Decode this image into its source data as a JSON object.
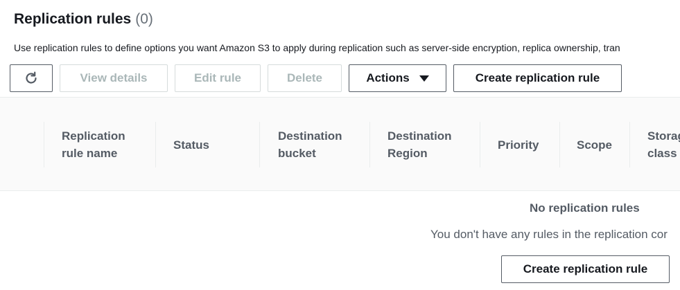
{
  "header": {
    "title": "Replication rules",
    "count": "(0)",
    "description": "Use replication rules to define options you want Amazon S3 to apply during replication such as server-side encryption, replica ownership, tran"
  },
  "toolbar": {
    "refresh_icon": "refresh-icon",
    "view_details_label": "View details",
    "edit_rule_label": "Edit rule",
    "delete_label": "Delete",
    "actions_label": "Actions",
    "create_label": "Create replication rule"
  },
  "table": {
    "columns": [
      {
        "line1": "Replication",
        "line2": "rule name"
      },
      {
        "line1": "Status",
        "line2": ""
      },
      {
        "line1": "Destination",
        "line2": "bucket"
      },
      {
        "line1": "Destination",
        "line2": "Region"
      },
      {
        "line1": "Priority",
        "line2": ""
      },
      {
        "line1": "Scope",
        "line2": ""
      },
      {
        "line1": "Storag",
        "line2": "class"
      }
    ]
  },
  "empty_state": {
    "title": "No replication rules",
    "text": "You don't have any rules in the replication cor",
    "button_label": "Create replication rule"
  },
  "colors": {
    "text_primary": "#16191f",
    "text_secondary": "#545b64",
    "disabled": "#aab7b8",
    "header_bg": "#fafafa"
  }
}
